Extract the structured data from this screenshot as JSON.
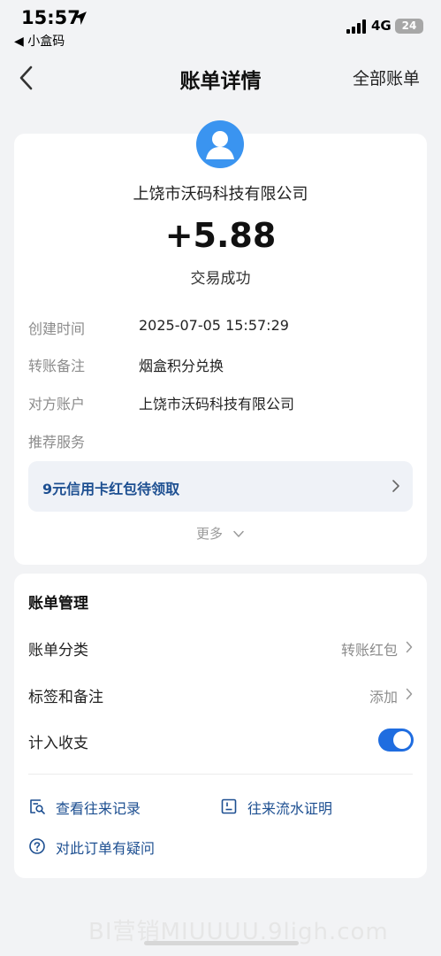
{
  "status_bar": {
    "time": "15:57",
    "back_app": "◀ 小盒码",
    "network": "4G",
    "battery": "24"
  },
  "nav": {
    "title": "账单详情",
    "right_link": "全部账单"
  },
  "transaction": {
    "counterparty": "上饶市沃码科技有限公司",
    "amount": "+5.88",
    "status": "交易成功",
    "details": [
      {
        "label": "创建时间",
        "value": "2025-07-05 15:57:29"
      },
      {
        "label": "转账备注",
        "value": "烟盒积分兑换"
      },
      {
        "label": "对方账户",
        "value": "上饶市沃码科技有限公司"
      }
    ],
    "recommend_label": "推荐服务",
    "promo_text": "9元信用卡红包待领取",
    "more_label": "更多"
  },
  "management": {
    "title": "账单管理",
    "category_label": "账单分类",
    "category_value": "转账红包",
    "tags_label": "标签和备注",
    "tags_value": "添加",
    "include_label": "计入收支",
    "include_enabled": true,
    "links": {
      "history": "查看往来记录",
      "statement": "往来流水证明",
      "question": "对此订单有疑问"
    }
  },
  "watermark": "BI营销MIUUUU.9ligh.com",
  "colors": {
    "accent": "#1f6de0",
    "link": "#1d4f91",
    "avatar": "#3a94f0",
    "background": "#f2f3f5"
  }
}
